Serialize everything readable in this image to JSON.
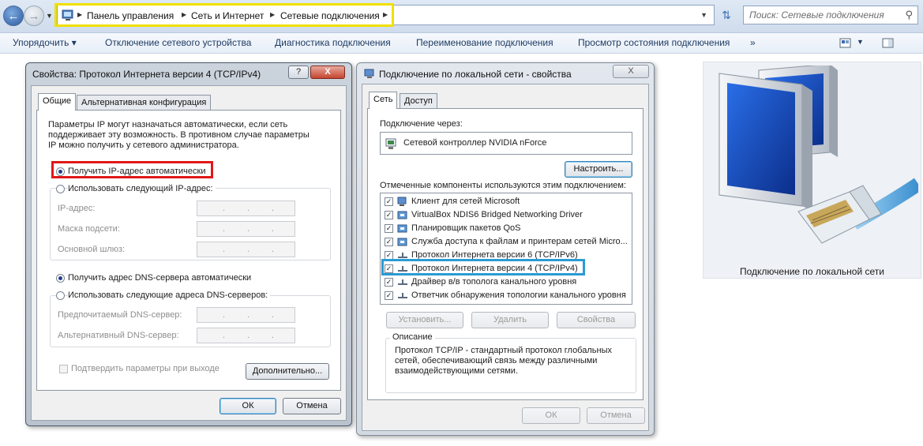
{
  "explorer": {
    "breadcrumb": [
      "Панель управления",
      "Сеть и Интернет",
      "Сетевые подключения"
    ],
    "search_placeholder": "Поиск: Сетевые подключения",
    "commands": [
      "Упорядочить",
      "Отключение сетевого устройства",
      "Диагностика подключения",
      "Переименование подключения",
      "Просмотр состояния подключения",
      "»"
    ],
    "preview_caption": "Подключение по локальной сети"
  },
  "ipv4_dialog": {
    "title": "Свойства: Протокол Интернета версии 4 (TCP/IPv4)",
    "help_btn": "?",
    "close_btn": "X",
    "tabs": [
      "Общие",
      "Альтернативная конфигурация"
    ],
    "description": [
      "Параметры IP могут назначаться автоматически, если сеть",
      "поддерживает эту возможность. В противном случае параметры",
      "IP можно получить у сетевого администратора."
    ],
    "radio_auto_ip": "Получить IP-адрес автоматически",
    "radio_manual_ip": "Использовать следующий IP-адрес:",
    "ip_label": "IP-адрес:",
    "mask_label": "Маска подсети:",
    "gateway_label": "Основной шлюз:",
    "radio_auto_dns": "Получить адрес DNS-сервера автоматически",
    "radio_manual_dns": "Использовать следующие адреса DNS-серверов:",
    "preferred_dns_label": "Предпочитаемый DNS-сервер:",
    "alternate_dns_label": "Альтернативный DNS-сервер:",
    "validate_on_exit": "Подтвердить параметры при выходе",
    "advanced_btn": "Дополнительно...",
    "ok_btn": "ОК",
    "cancel_btn": "Отмена"
  },
  "lan_dialog": {
    "title": "Подключение по локальной сети - свойства",
    "close_btn": "X",
    "tabs": [
      "Сеть",
      "Доступ"
    ],
    "connect_using_label": "Подключение через:",
    "adapter_name": "Сетевой контроллер NVIDIA nForce",
    "configure_btn": "Настроить...",
    "components_label": "Отмеченные компоненты используются этим подключением:",
    "components": [
      {
        "label": "Клиент для сетей Microsoft",
        "checked": true,
        "icon": "network-client-icon"
      },
      {
        "label": "VirtualBox NDIS6 Bridged Networking Driver",
        "checked": true,
        "icon": "network-service-icon"
      },
      {
        "label": "Планировщик пакетов QoS",
        "checked": true,
        "icon": "network-service-icon"
      },
      {
        "label": "Служба доступа к файлам и принтерам сетей Micro...",
        "checked": true,
        "icon": "network-service-icon"
      },
      {
        "label": "Протокол Интернета версии 6 (TCP/IPv6)",
        "checked": true,
        "icon": "protocol-icon"
      },
      {
        "label": "Протокол Интернета версии 4 (TCP/IPv4)",
        "checked": true,
        "icon": "protocol-icon"
      },
      {
        "label": "Драйвер в/в тополога канального уровня",
        "checked": true,
        "icon": "protocol-icon"
      },
      {
        "label": "Ответчик обнаружения топологии канального уровня",
        "checked": true,
        "icon": "protocol-icon"
      }
    ],
    "install_btn": "Установить...",
    "remove_btn": "Удалить",
    "properties_btn": "Свойства",
    "description_group": "Описание",
    "description": [
      "Протокол TCP/IP - стандартный протокол глобальных",
      "сетей, обеспечивающий связь между различными",
      "взаимодействующими сетями."
    ],
    "ok_btn": "ОК",
    "cancel_btn": "Отмена"
  },
  "colors": {
    "highlight_yellow": "#f0e000",
    "highlight_red": "#e01818",
    "highlight_blue": "#2a9bd4"
  }
}
